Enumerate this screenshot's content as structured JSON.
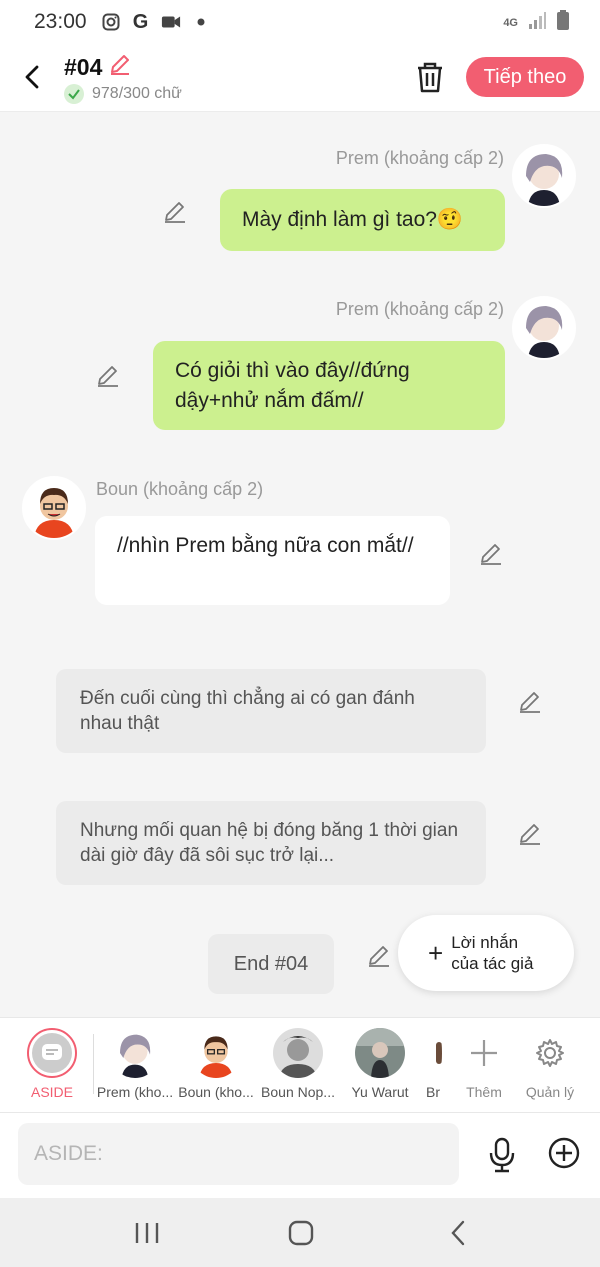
{
  "status": {
    "time": "23:00",
    "network": "4G"
  },
  "header": {
    "title": "#04",
    "word_count": "978/300 chữ",
    "next_label": "Tiếp theo"
  },
  "messages": [
    {
      "speaker": "Prem (khoảng cấp 2)",
      "text": "Mày định làm gì tao?🤨"
    },
    {
      "speaker": "Prem (khoảng cấp 2)",
      "text": "Có giỏi thì vào đây//đứng dậy+nhử nắm đấm//"
    },
    {
      "speaker": "Boun (khoảng cấp 2)",
      "text": "//nhìn Prem bằng nữa con mắt//"
    },
    {
      "text": "Đến cuối cùng thì chẳng ai có gan đánh nhau thật"
    },
    {
      "text": "Nhưng mối quan hệ bị đóng băng 1 thời gian dài giờ đây đã sôi sục trở lại..."
    }
  ],
  "end_label": "End #04",
  "fab": {
    "label_line1": "Lời nhắn",
    "label_line2": "của tác giả"
  },
  "characters": [
    {
      "label": "ASIDE"
    },
    {
      "label": "Prem (kho..."
    },
    {
      "label": "Boun (kho..."
    },
    {
      "label": "Boun Nop..."
    },
    {
      "label": "Yu Warut"
    },
    {
      "label": "Br"
    },
    {
      "label": "Thêm"
    },
    {
      "label": "Quản lý"
    }
  ],
  "input": {
    "placeholder": "ASIDE:"
  },
  "colors": {
    "accent": "#f25e71",
    "bubble_green": "#ccf08f",
    "bubble_gray": "#ebebeb"
  }
}
